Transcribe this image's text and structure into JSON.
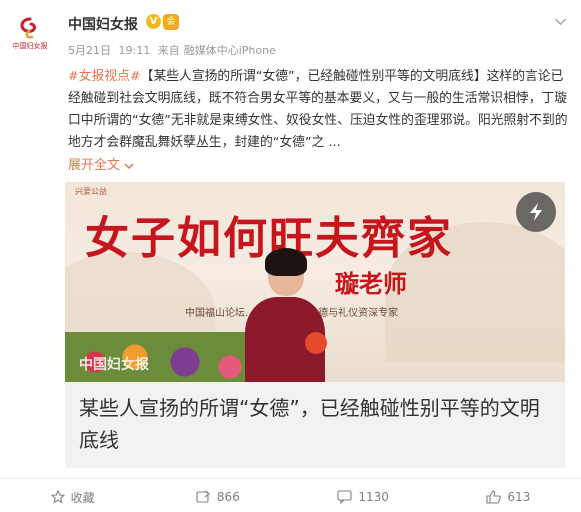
{
  "account": {
    "avatar_text": "中国妇女报",
    "username": "中国妇女报",
    "verified_mark": "V",
    "vip_mark": "会"
  },
  "meta": {
    "date": "5月21日",
    "time": "19:11",
    "source_prefix": "来自",
    "source": "融媒体中心iPhone"
  },
  "post": {
    "hashtag": "#女报视点#",
    "text": "【某些人宣扬的所谓“女德”，已经触碰性别平等的文明底线】这样的言论已经触碰到社会文明底线，既不符合男女平等的基本要义，又与一般的生活常识相悖，丁璇口中所谓的“女德”无非就是束缚女性、奴役女性、压迫女性的歪理邪说。阳光照射不到的地方才会群魔乱舞妖孽丛生，封建的“女德”之",
    "ellipsis": " ...",
    "expand_label": "展开全文",
    "expand_icon": "chevron-down-icon"
  },
  "card": {
    "banner_small": "兴爱公益",
    "banner_title": "女子如何旺夫齊家",
    "banner_teacher": "璇老师",
    "banner_subtitle": "中国福山论坛…讲师， 著名女德与礼仪资深专家",
    "watermark": "中国妇女报",
    "play_icon": "lightning-icon",
    "title": "某些人宣扬的所谓“女德”，已经触碰性别平等的文明底线"
  },
  "actions": {
    "favorite_label": "收藏",
    "repost_count": "866",
    "comment_count": "1130",
    "like_count": "613"
  },
  "colors": {
    "accent": "#eb7350",
    "banner_red": "#c4161c",
    "text": "#333333",
    "muted": "#999999"
  }
}
